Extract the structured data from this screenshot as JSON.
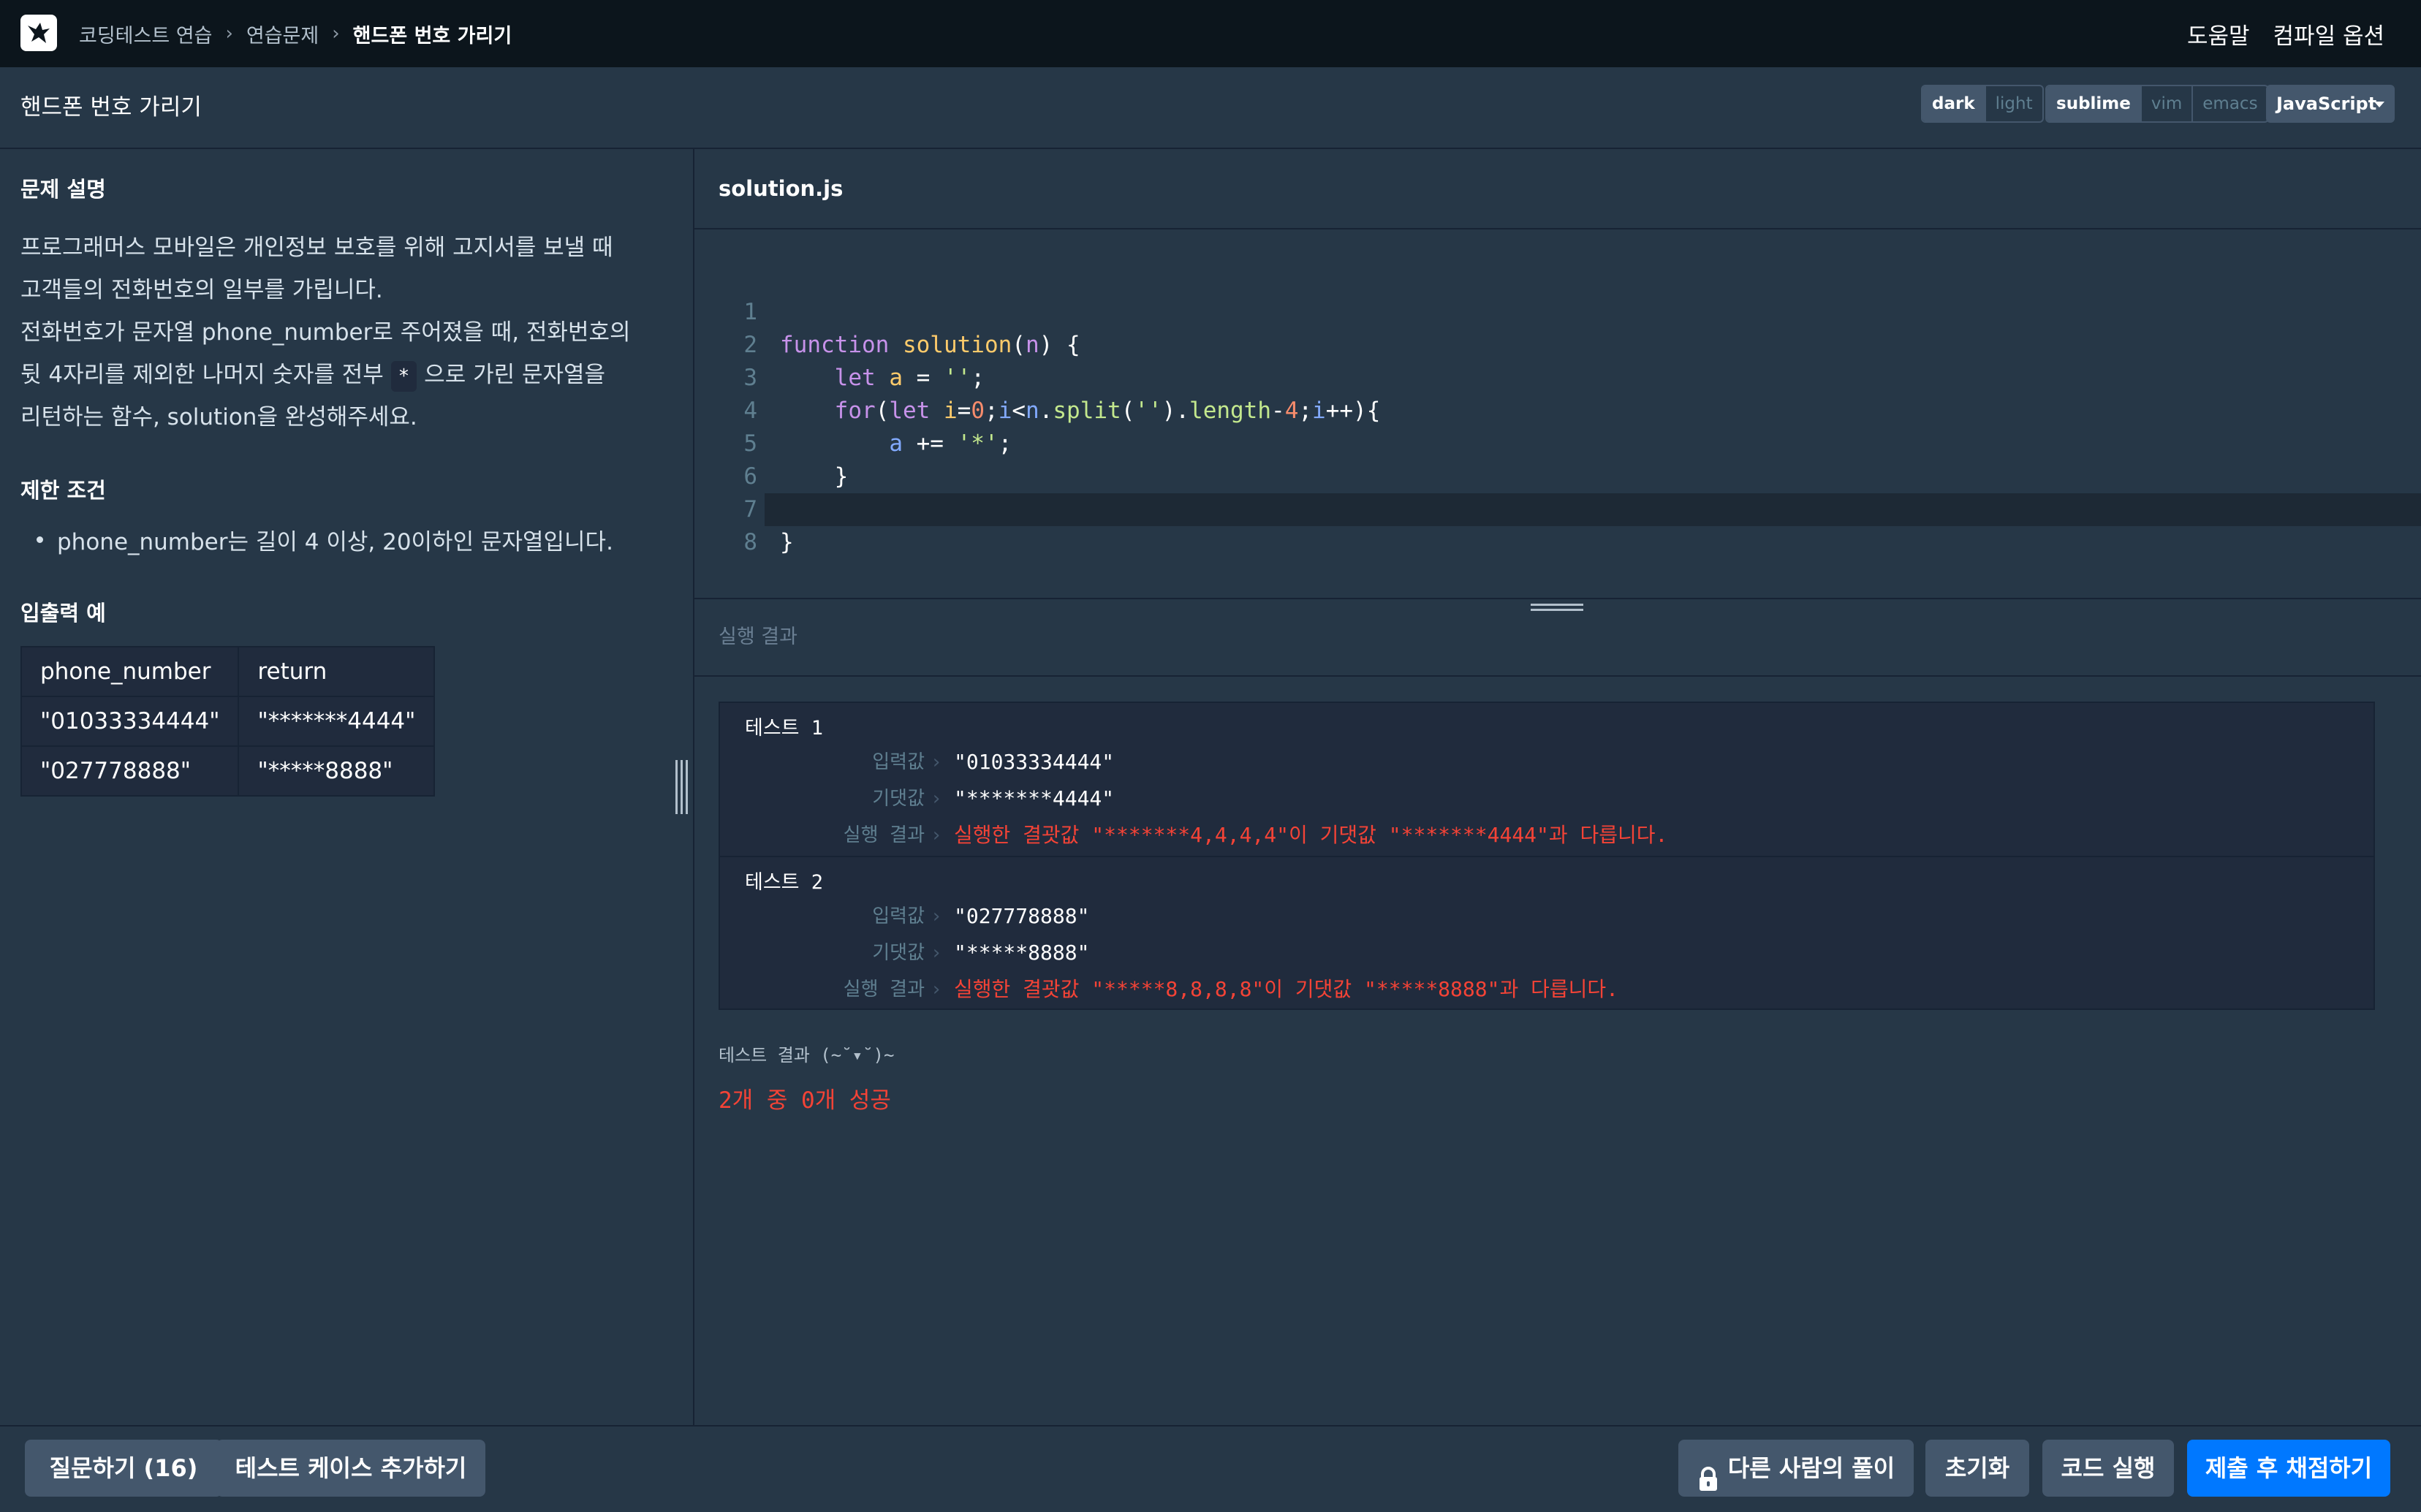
{
  "nav": {
    "breadcrumbs": [
      "코딩테스트 연습",
      "연습문제",
      "핸드폰 번호 가리기"
    ],
    "help": "도움말",
    "compile_options": "컴파일 옵션"
  },
  "title": "핸드폰 번호 가리기",
  "toolbar": {
    "theme": [
      "dark",
      "light"
    ],
    "keymap": [
      "sublime",
      "vim",
      "emacs"
    ],
    "language": "JavaScript"
  },
  "guide": {
    "section_description": "문제 설명",
    "description_lines": [
      "프로그래머스 모바일은 개인정보 보호를 위해 고지서를 보낼 때",
      "고객들의 전화번호의 일부를 가립니다.",
      "전화번호가 문자열 phone_number로 주어졌을 때, 전화번호의"
    ],
    "desc_line4_pre": "뒷 4자리를 제외한 나머지 숫자를 전부",
    "desc_line4_code": "*",
    "desc_line4_post": "으로 가린 문자열을",
    "desc_line5": "리턴하는 함수, solution을 완성해주세요.",
    "section_constraints": "제한 조건",
    "constraint": "phone_number는 길이 4 이상, 20이하인 문자열입니다.",
    "section_examples": "입출력 예",
    "table": {
      "headers": [
        "phone_number",
        "return"
      ],
      "rows": [
        [
          "\"01033334444\"",
          "\"*******4444\""
        ],
        [
          "\"027778888\"",
          "\"*****8888\""
        ]
      ]
    }
  },
  "editor": {
    "filename": "solution.js",
    "line_numbers": [
      "1",
      "2",
      "3",
      "4",
      "5",
      "6",
      "7",
      "8"
    ]
  },
  "output": {
    "title": "실행 결과",
    "tests": [
      {
        "name": "테스트 1",
        "input_label": "입력값",
        "input": "\"01033334444\"",
        "expected_label": "기댓값",
        "expected": "\"*******4444\"",
        "result_label": "실행 결과",
        "result": "실행한 결괏값 \"*******4,4,4,4\"이 기댓값 \"*******4444\"과 다릅니다."
      },
      {
        "name": "테스트 2",
        "input_label": "입력값",
        "input": "\"027778888\"",
        "expected_label": "기댓값",
        "expected": "\"*****8888\"",
        "result_label": "실행 결과",
        "result": "실행한 결괏값 \"*****8,8,8,8\"이 기댓값 \"*****8888\"과 다릅니다."
      }
    ],
    "summary_label": "테스트 결과 (~˘▾˘)~",
    "summary": "2개 중 0개 성공"
  },
  "bottom": {
    "questions": "질문하기 (16)",
    "add_testcase": "테스트 케이스 추가하기",
    "others_solutions": "다른 사람의 풀이",
    "reset": "초기화",
    "run": "코드 실행",
    "submit": "제출 후 채점하기"
  },
  "colors": {
    "accent": "#0078ff",
    "error": "#f44336",
    "background": "#263747"
  }
}
